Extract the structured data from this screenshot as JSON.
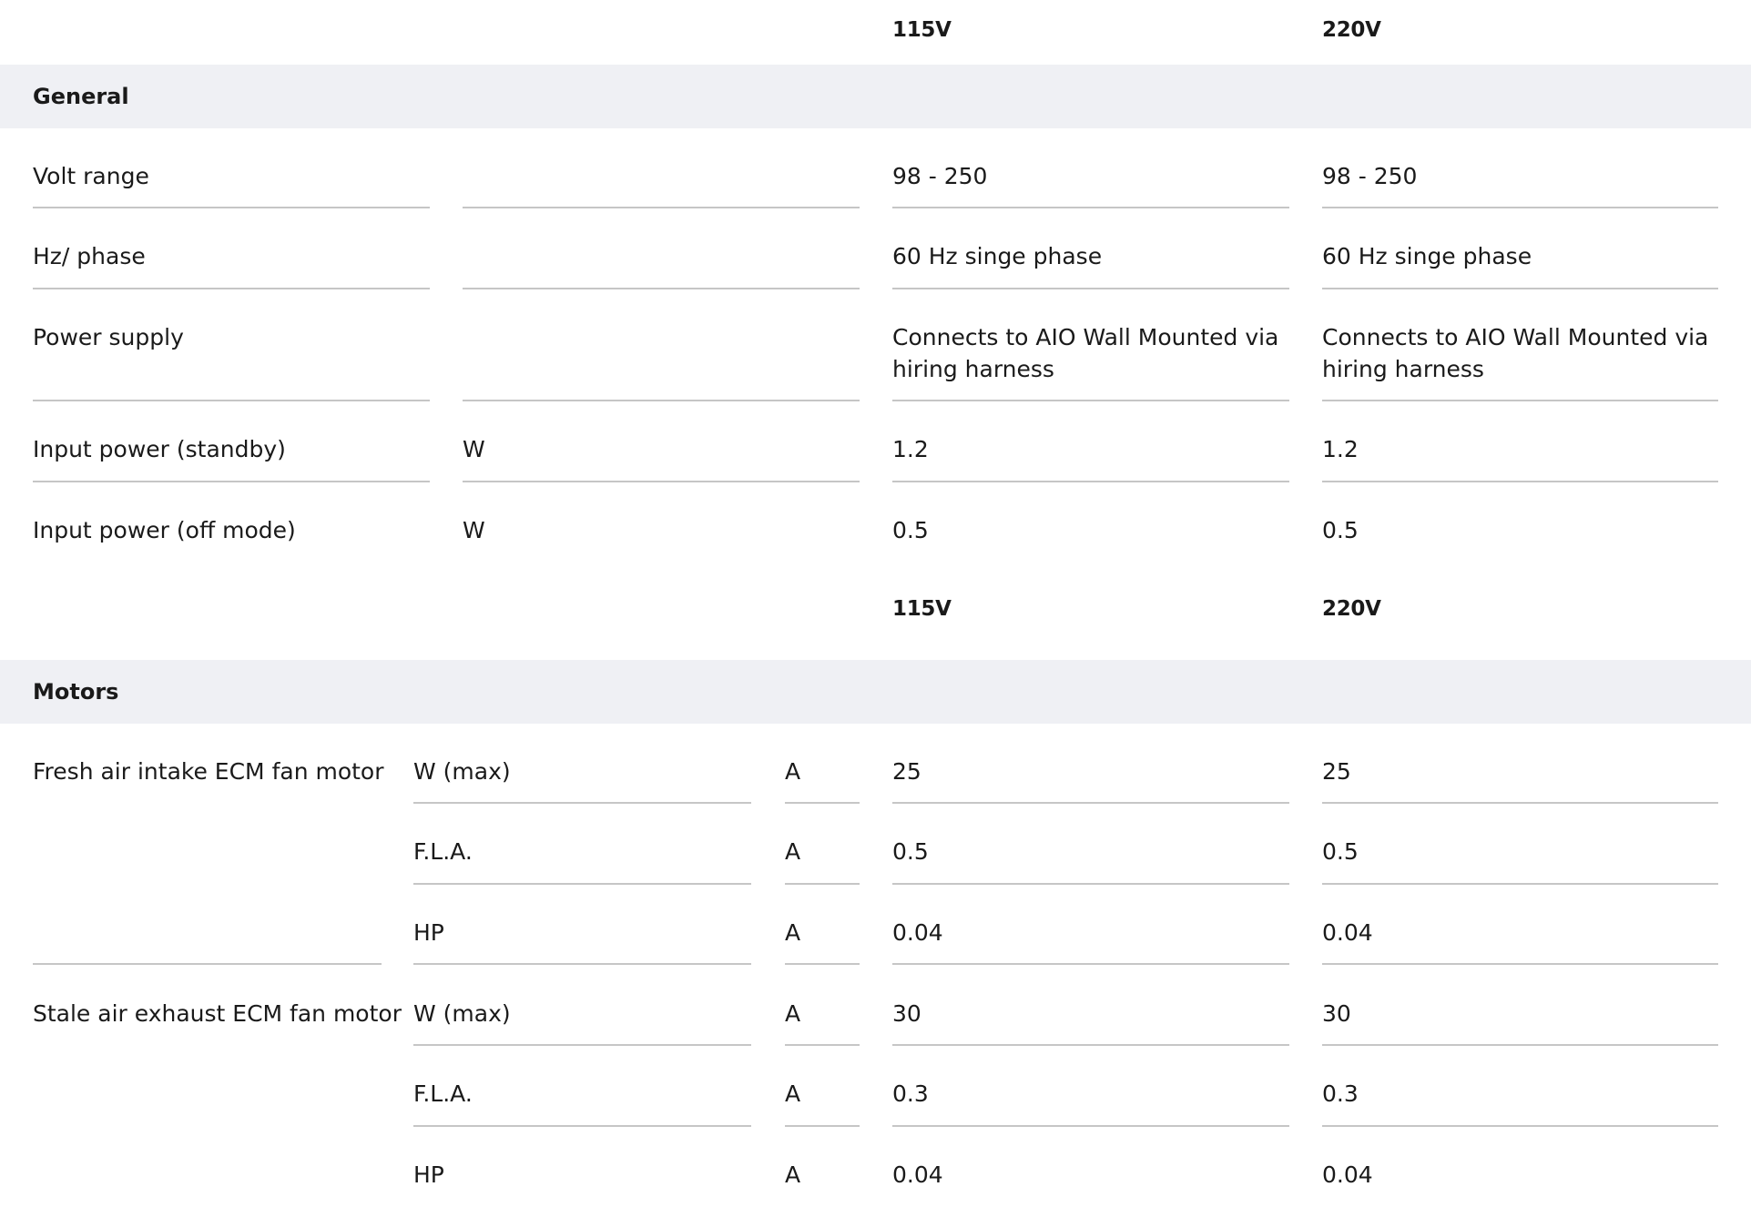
{
  "columns": {
    "col1": "115V",
    "col2": "220V"
  },
  "general": {
    "title": "General",
    "rows": [
      {
        "label": "Volt range",
        "unit": "",
        "v1": "98 - 250",
        "v2": "98 - 250"
      },
      {
        "label": "Hz/ phase",
        "unit": "",
        "v1": "60 Hz singe phase",
        "v2": "60 Hz singe phase"
      },
      {
        "label": "Power supply",
        "unit": "",
        "v1": "Connects to AIO Wall Mounted via hiring harness",
        "v2": "Connects to AIO Wall Mounted via hiring harness"
      },
      {
        "label": "Input power (standby)",
        "unit": "W",
        "v1": "1.2",
        "v2": "1.2"
      },
      {
        "label": "Input power (off mode)",
        "unit": "W",
        "v1": "0.5",
        "v2": "0.5"
      }
    ]
  },
  "motors": {
    "title": "Motors",
    "groups": [
      {
        "label": "Fresh air intake ECM fan motor",
        "rows": [
          {
            "param": "W (max)",
            "unit": "A",
            "v1": "25",
            "v2": "25"
          },
          {
            "param": "F.L.A.",
            "unit": "A",
            "v1": "0.5",
            "v2": "0.5"
          },
          {
            "param": "HP",
            "unit": "A",
            "v1": "0.04",
            "v2": "0.04"
          }
        ]
      },
      {
        "label": "Stale air exhaust ECM fan motor",
        "rows": [
          {
            "param": "W (max)",
            "unit": "A",
            "v1": "30",
            "v2": "30"
          },
          {
            "param": "F.L.A.",
            "unit": "A",
            "v1": "0.3",
            "v2": "0.3"
          },
          {
            "param": "HP",
            "unit": "A",
            "v1": "0.04",
            "v2": "0.04"
          }
        ]
      }
    ]
  }
}
